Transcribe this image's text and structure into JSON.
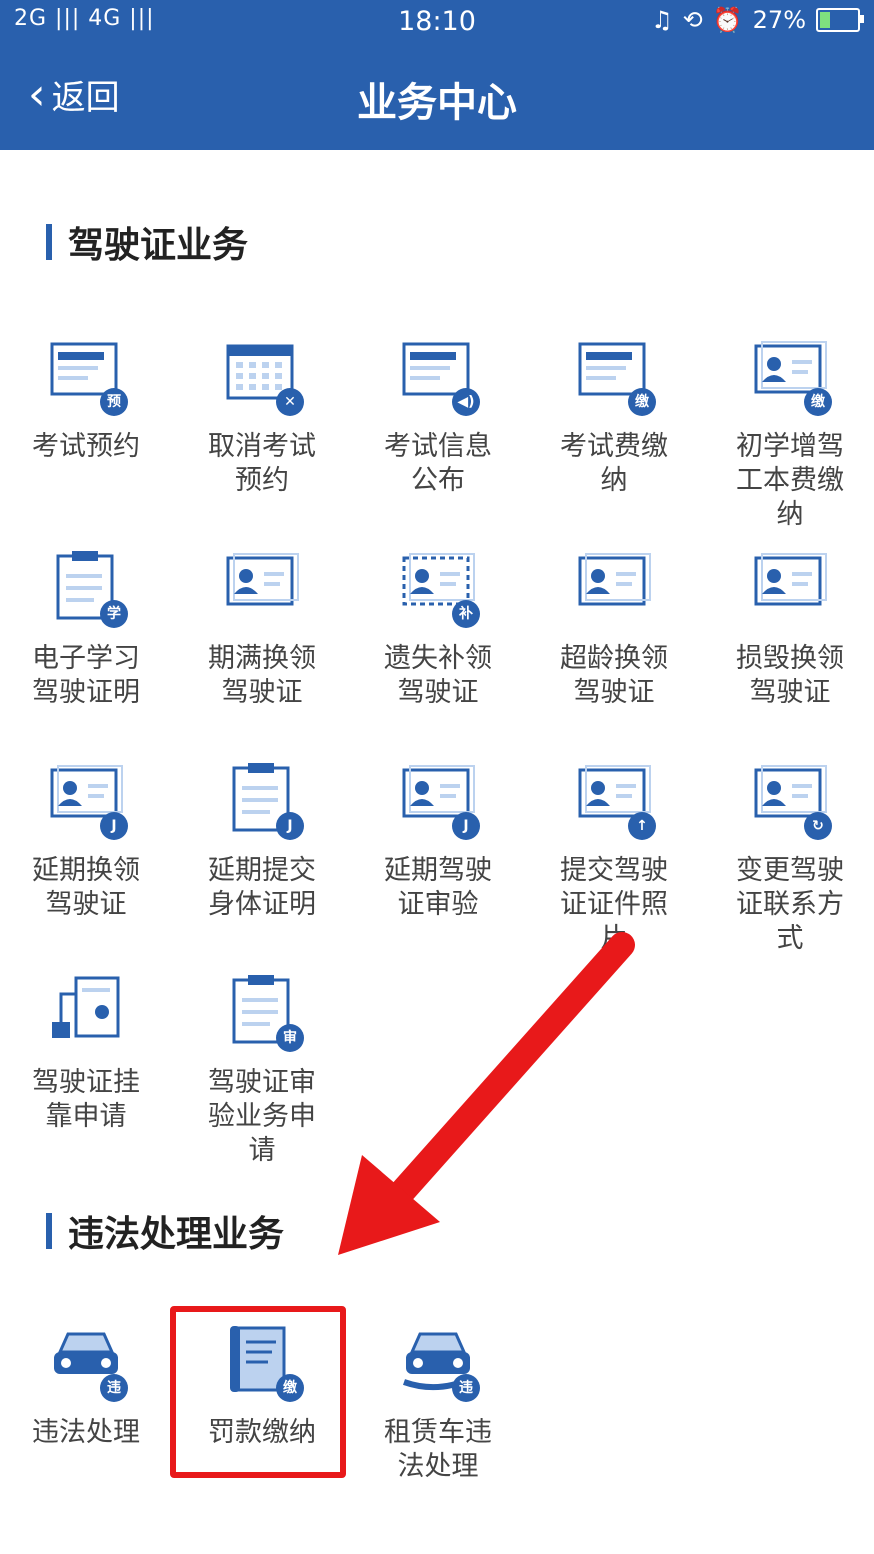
{
  "status": {
    "signal": "2G |||  4G |||",
    "time": "18:10",
    "battery_pct": "27%",
    "battery_level": 0.27
  },
  "header": {
    "back_label": "返回",
    "title": "业务中心"
  },
  "sections": {
    "license": {
      "title": "驾驶证业务"
    },
    "violation": {
      "title": "违法处理业务"
    }
  },
  "license_items": [
    {
      "label": "考试预约",
      "badge": "预",
      "icon": "form-icon"
    },
    {
      "label": "取消考试预约",
      "badge": "✕",
      "icon": "calendar-icon"
    },
    {
      "label": "考试信息公布",
      "badge": "◀)",
      "icon": "announcement-icon"
    },
    {
      "label": "考试费缴纳",
      "badge": "缴",
      "icon": "card-icon"
    },
    {
      "label": "初学增驾工本费缴纳",
      "badge": "缴",
      "icon": "id-card-icon"
    },
    {
      "label": "电子学习驾驶证明",
      "badge": "学",
      "icon": "clipboard-icon"
    },
    {
      "label": "期满换领驾驶证",
      "badge": "",
      "icon": "license-icon"
    },
    {
      "label": "遗失补领驾驶证",
      "badge": "补",
      "icon": "license-dashed-icon"
    },
    {
      "label": "超龄换领驾驶证",
      "badge": "",
      "icon": "license-clock-icon"
    },
    {
      "label": "损毁换领驾驶证",
      "badge": "",
      "icon": "license-damaged-icon"
    },
    {
      "label": "延期换领驾驶证",
      "badge": "J",
      "icon": "license-delay-icon"
    },
    {
      "label": "延期提交身体证明",
      "badge": "J",
      "icon": "health-icon"
    },
    {
      "label": "延期驾驶证审验",
      "badge": "J",
      "icon": "review-icon"
    },
    {
      "label": "提交驾驶证证件照片",
      "badge": "↑",
      "icon": "photo-upload-icon"
    },
    {
      "label": "变更驾驶证联系方式",
      "badge": "↻",
      "icon": "phone-contact-icon"
    },
    {
      "label": "驾驶证挂靠申请",
      "badge": "",
      "icon": "affiliation-icon"
    },
    {
      "label": "驾驶证审验业务申请",
      "badge": "审",
      "icon": "review-apply-icon"
    }
  ],
  "violation_items": [
    {
      "label": "违法处理",
      "badge": "违",
      "icon": "car-icon"
    },
    {
      "label": "罚款缴纳",
      "badge": "缴",
      "icon": "scroll-icon"
    },
    {
      "label": "租赁车违法处理",
      "badge": "违",
      "icon": "car-hand-icon"
    }
  ],
  "colors": {
    "primary": "#2960ad",
    "highlight": "#e8191a",
    "icon_light": "#bcd2ef"
  }
}
